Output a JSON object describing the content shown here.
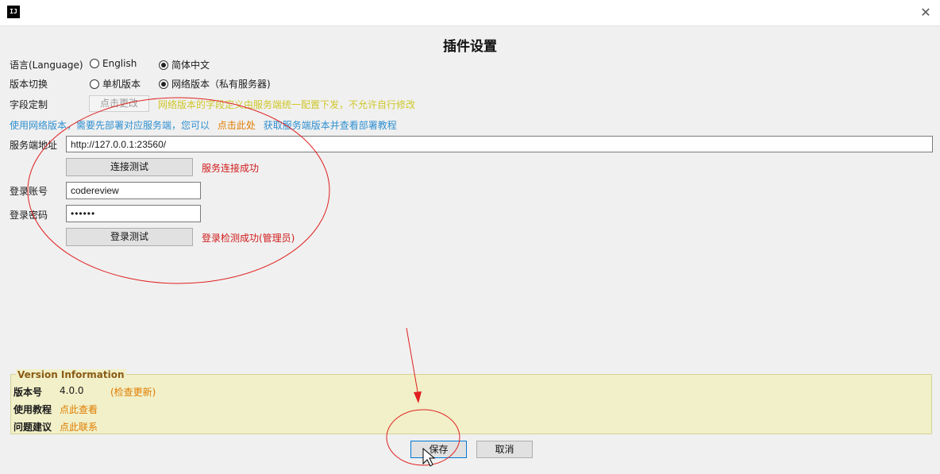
{
  "window": {
    "app_icon_text": "IJ",
    "close_glyph": "✕",
    "title": "插件设置"
  },
  "language": {
    "label": "语言(Language)",
    "options": [
      {
        "label": "English",
        "selected": false
      },
      {
        "label": "简体中文",
        "selected": true
      }
    ]
  },
  "version_switch": {
    "label": "版本切换",
    "options": [
      {
        "label": "单机版本",
        "selected": false
      },
      {
        "label": "网络版本（私有服务器)",
        "selected": true
      }
    ]
  },
  "field_custom": {
    "label": "字段定制",
    "button": "点击更改",
    "note": "网络版本的字段定义由服务端统一配置下发，不允许自行修改"
  },
  "network_hint": {
    "prefix": "使用网络版本，需要先部署对应服务端，您可以",
    "link": "点击此处",
    "suffix": "获取服务端版本并查看部署教程"
  },
  "server": {
    "label": "服务端地址",
    "value": "http://127.0.0.1:23560/",
    "test_button": "连接测试",
    "test_result": "服务连接成功"
  },
  "login": {
    "account_label": "登录账号",
    "account_value": "codereview",
    "password_label": "登录密码",
    "password_value": "••••••",
    "test_button": "登录测试",
    "test_result": "登录检测成功(管理员)"
  },
  "version_info": {
    "legend": "Version Information",
    "version_label": "版本号",
    "version_value": "4.0.0",
    "check_update": "(检查更新)",
    "tutorial_label": "使用教程",
    "tutorial_link": "点此查看",
    "feedback_label": "问题建议",
    "feedback_link": "点此联系"
  },
  "actions": {
    "save": "保存",
    "cancel": "取消"
  },
  "colors": {
    "annotation": "#e02020",
    "accent_link": "#e07b00",
    "info_link": "#2f8fd0",
    "success_text": "#d11b1b"
  },
  "icons": {
    "app": "intellij-app-icon",
    "close": "close-icon",
    "cursor": "mouse-pointer-icon"
  }
}
